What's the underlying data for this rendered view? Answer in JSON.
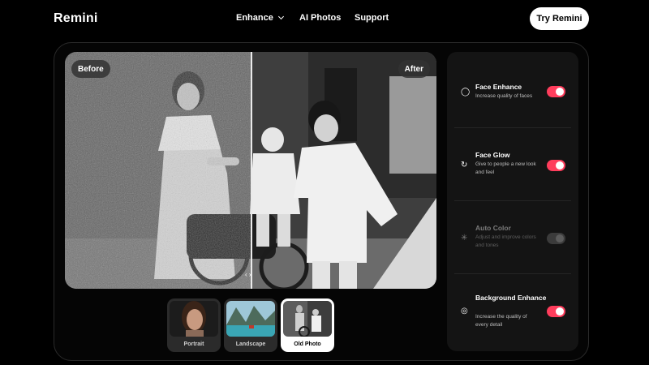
{
  "header": {
    "logo": "Remini",
    "nav": [
      {
        "label": "Enhance",
        "has_dropdown": true
      },
      {
        "label": "AI Photos"
      },
      {
        "label": "Support"
      }
    ],
    "cta_label": "Try Remini"
  },
  "compare": {
    "before_label": "Before",
    "after_label": "After",
    "handle_glyph": "‹ ›"
  },
  "samples": [
    {
      "label": "Portrait",
      "selected": false
    },
    {
      "label": "Landscape",
      "selected": false
    },
    {
      "label": "Old Photo",
      "selected": true
    }
  ],
  "features": [
    {
      "title": "Face Enhance",
      "description": "Increase quality of faces",
      "enabled": true,
      "icon": "face-enhance-icon"
    },
    {
      "title": "Face Glow",
      "description": "Give to people a new look and feel",
      "enabled": true,
      "icon": "face-glow-icon"
    },
    {
      "title": "Auto Color",
      "description": "Adjust and improve colors and tones",
      "enabled": false,
      "icon": "sparkle-icon"
    },
    {
      "title": "Background Enhance",
      "description": "Increase the quality of every detail",
      "enabled": true,
      "icon": "background-icon"
    }
  ],
  "colors": {
    "accent": "#ff3d5c",
    "panel": "#141414",
    "background": "#000000"
  }
}
